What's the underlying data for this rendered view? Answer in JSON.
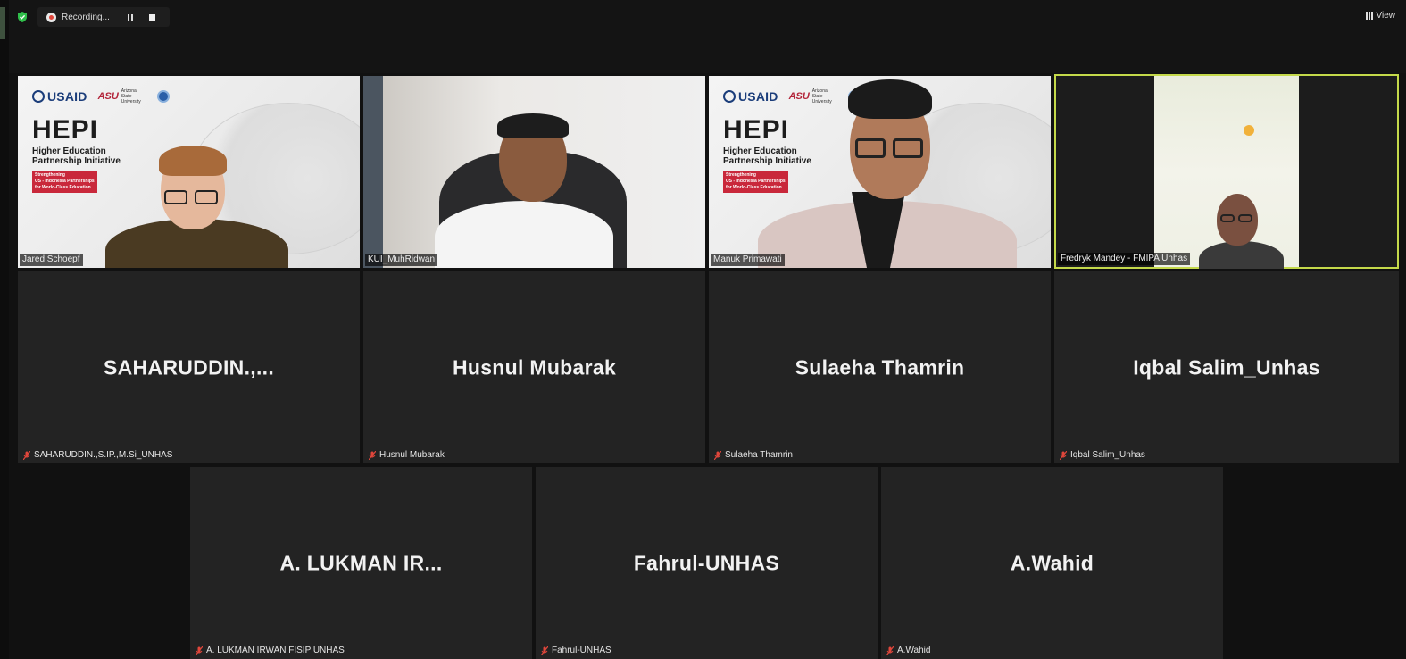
{
  "recording": {
    "label": "Recording..."
  },
  "view_button": {
    "label": "View"
  },
  "hepi_slide": {
    "usaid": "USAID",
    "asu": "ASU",
    "asu_sub": "Arizona State University",
    "title": "HEPI",
    "subtitle_1": "Higher Education",
    "subtitle_2": "Partnership Initiative",
    "tag_1": "Strengthening",
    "tag_2": "US - Indonesia Partnerships",
    "tag_3": "for World-Class Education"
  },
  "video_tiles": [
    {
      "name": "Jared Schoepf"
    },
    {
      "name": "KUI_MuhRidwan"
    },
    {
      "name": "Manuk Primawati"
    },
    {
      "name": "Fredryk Mandey - FMIPA Unhas"
    }
  ],
  "name_tiles_row2": [
    {
      "display": "SAHARUDDIN.,...",
      "label": "SAHARUDDIN.,S.IP.,M.Si_UNHAS"
    },
    {
      "display": "Husnul Mubarak",
      "label": "Husnul Mubarak"
    },
    {
      "display": "Sulaeha Thamrin",
      "label": "Sulaeha Thamrin"
    },
    {
      "display": "Iqbal Salim_Unhas",
      "label": "Iqbal Salim_Unhas"
    }
  ],
  "name_tiles_row3": [
    {
      "display": "A. LUKMAN IR...",
      "label": "A. LUKMAN IRWAN FISIP UNHAS"
    },
    {
      "display": "Fahrul-UNHAS",
      "label": "Fahrul-UNHAS"
    },
    {
      "display": "A.Wahid",
      "label": "A.Wahid"
    }
  ],
  "colors": {
    "active_speaker_outline": "#c4d94a",
    "tile_bg": "#232323",
    "muted_icon": "#e0463b"
  }
}
